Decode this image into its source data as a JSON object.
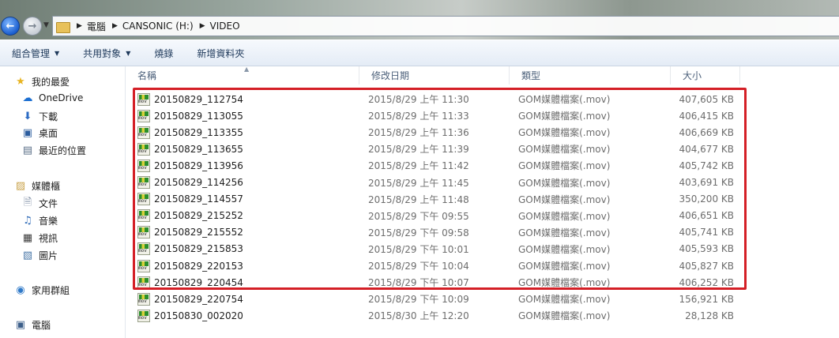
{
  "address": {
    "crumbs": [
      "電腦",
      "CANSONIC (H:)",
      "VIDEO"
    ],
    "history_icon": "chevron-down-icon",
    "back_icon": "back-arrow-icon",
    "forward_icon": "forward-arrow-icon"
  },
  "toolbar": {
    "organize": "組合管理",
    "share": "共用對象",
    "burn": "燒錄",
    "new_folder": "新增資料夾"
  },
  "nav": {
    "favorites": "我的最愛",
    "onedrive": "OneDrive",
    "downloads": "下載",
    "desktop": "桌面",
    "recent": "最近的位置",
    "libraries": "媒體櫃",
    "documents": "文件",
    "music": "音樂",
    "videos": "視訊",
    "pictures": "圖片",
    "homegroup": "家用群組",
    "computer": "電腦"
  },
  "columns": {
    "name": "名稱",
    "date": "修改日期",
    "type": "類型",
    "size": "大小"
  },
  "files": [
    {
      "name": "20150829_112754",
      "date": "2015/8/29 上午 11:30",
      "type": "GOM媒體檔案(.mov)",
      "size": "407,605 KB"
    },
    {
      "name": "20150829_113055",
      "date": "2015/8/29 上午 11:33",
      "type": "GOM媒體檔案(.mov)",
      "size": "406,415 KB"
    },
    {
      "name": "20150829_113355",
      "date": "2015/8/29 上午 11:36",
      "type": "GOM媒體檔案(.mov)",
      "size": "406,669 KB"
    },
    {
      "name": "20150829_113655",
      "date": "2015/8/29 上午 11:39",
      "type": "GOM媒體檔案(.mov)",
      "size": "404,677 KB"
    },
    {
      "name": "20150829_113956",
      "date": "2015/8/29 上午 11:42",
      "type": "GOM媒體檔案(.mov)",
      "size": "405,742 KB"
    },
    {
      "name": "20150829_114256",
      "date": "2015/8/29 上午 11:45",
      "type": "GOM媒體檔案(.mov)",
      "size": "403,691 KB"
    },
    {
      "name": "20150829_114557",
      "date": "2015/8/29 上午 11:48",
      "type": "GOM媒體檔案(.mov)",
      "size": "350,200 KB"
    },
    {
      "name": "20150829_215252",
      "date": "2015/8/29 下午 09:55",
      "type": "GOM媒體檔案(.mov)",
      "size": "406,651 KB"
    },
    {
      "name": "20150829_215552",
      "date": "2015/8/29 下午 09:58",
      "type": "GOM媒體檔案(.mov)",
      "size": "405,741 KB"
    },
    {
      "name": "20150829_215853",
      "date": "2015/8/29 下午 10:01",
      "type": "GOM媒體檔案(.mov)",
      "size": "405,593 KB"
    },
    {
      "name": "20150829_220153",
      "date": "2015/8/29 下午 10:04",
      "type": "GOM媒體檔案(.mov)",
      "size": "405,827 KB"
    },
    {
      "name": "20150829_220454",
      "date": "2015/8/29 下午 10:07",
      "type": "GOM媒體檔案(.mov)",
      "size": "406,252 KB"
    },
    {
      "name": "20150829_220754",
      "date": "2015/8/29 下午 10:09",
      "type": "GOM媒體檔案(.mov)",
      "size": "156,921 KB"
    },
    {
      "name": "20150830_002020",
      "date": "2015/8/30 上午 12:20",
      "type": "GOM媒體檔案(.mov)",
      "size": "28,128 KB"
    }
  ],
  "highlight_color": "#d41f26"
}
